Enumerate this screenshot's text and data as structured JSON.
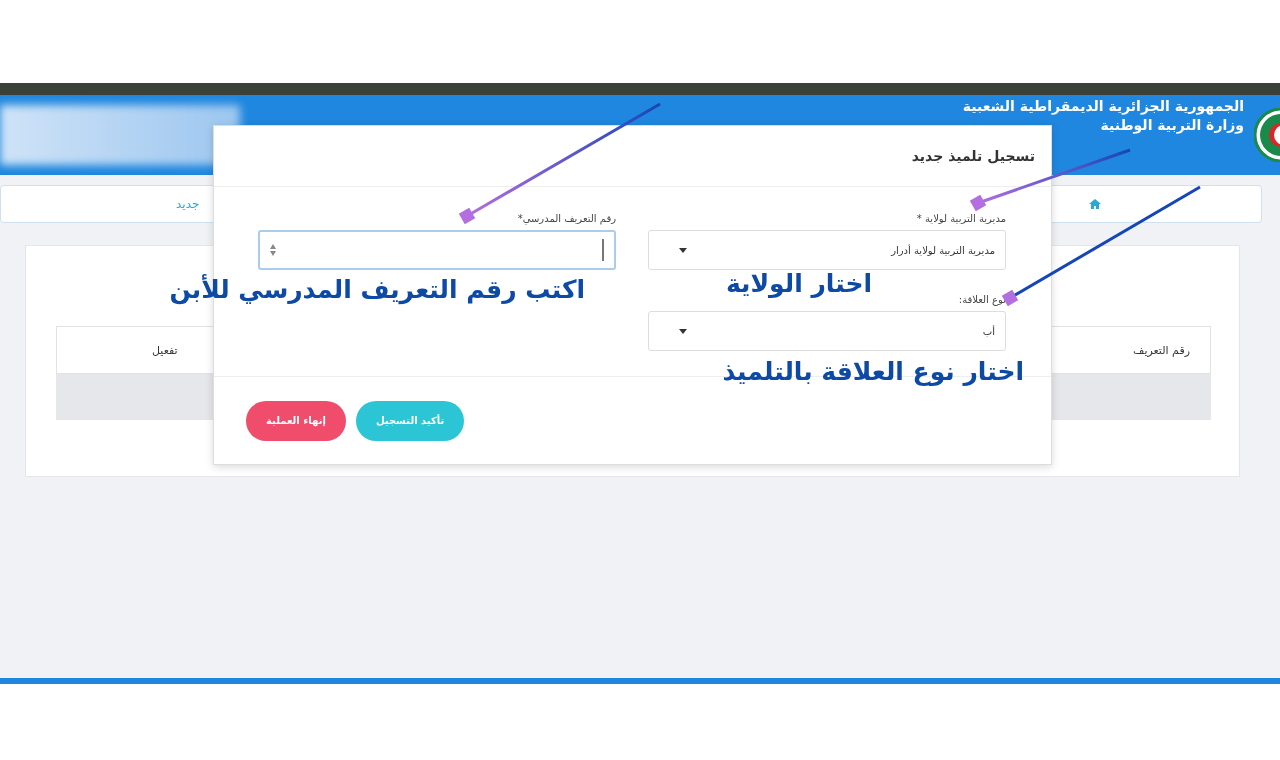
{
  "header": {
    "title_line_1": "الجمهورية الجزائرية الديمقراطية الشعبية",
    "title_line_2": "وزارة التربية الوطنية"
  },
  "breadcrumb": {
    "current": "جديد"
  },
  "table": {
    "columns": [
      "رقم التعريف",
      "تفعيل"
    ]
  },
  "dialog": {
    "title": "تسجيل تلميذ جديد",
    "fields": [
      {
        "kind": "select",
        "label": "مديرية التربية لولاية *",
        "value": "مديرية التربية لولاية أدرار"
      },
      {
        "kind": "select",
        "label": "نوع العلاقة:",
        "value": "أب"
      },
      {
        "kind": "number",
        "label": "رقم التعريف المدرسي*"
      }
    ],
    "buttons": [
      {
        "kind": "confirm",
        "label": "تأكيد التسجيل"
      },
      {
        "kind": "cancel",
        "label": "إنهاء العملية"
      }
    ]
  },
  "annotations": [
    {
      "text": "اختار الولاية"
    },
    {
      "text": "اختار نوع العلاقة بالتلميذ"
    },
    {
      "text": "اكتب رقم التعريف المدرسي للأبن"
    }
  ]
}
